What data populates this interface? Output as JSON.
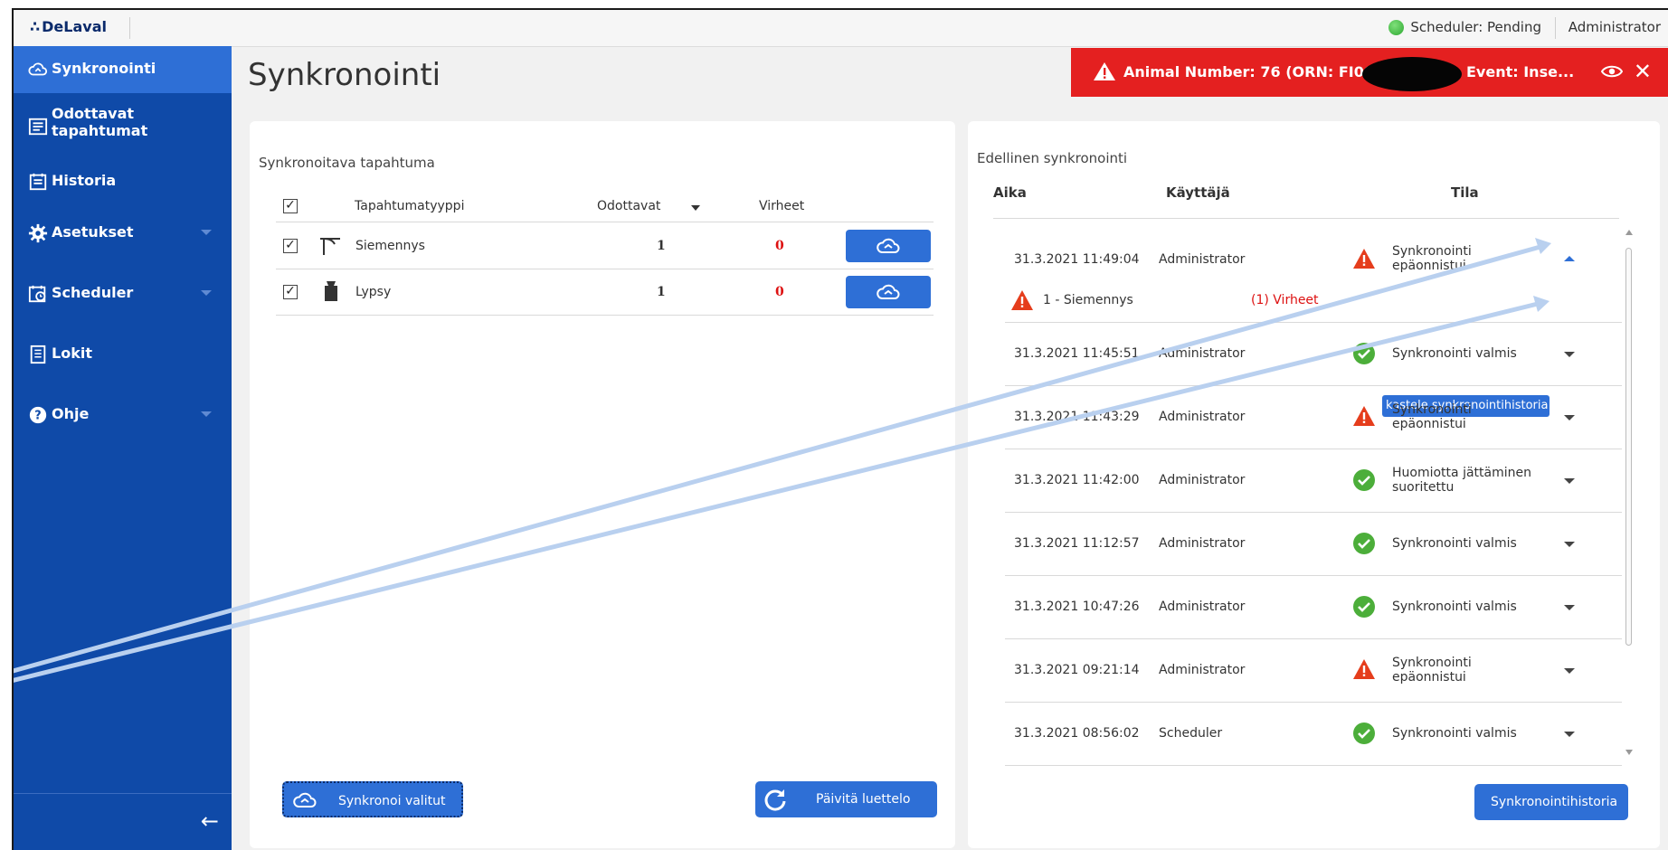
{
  "topbar": {
    "logo": "DeLaval",
    "scheduler_status": "Scheduler: Pending",
    "user": "Administrator"
  },
  "sidebar": {
    "items": [
      {
        "label": "Synkronointi",
        "icon": "cloud-sync-icon",
        "active": true
      },
      {
        "label": "Odottavat tapahtumat",
        "icon": "pending-list-icon"
      },
      {
        "label": "Historia",
        "icon": "history-icon"
      },
      {
        "label": "Asetukset",
        "icon": "gear-icon",
        "has_submenu": true
      },
      {
        "label": "Scheduler",
        "icon": "calendar-clock-icon",
        "has_submenu": true
      },
      {
        "label": "Lokit",
        "icon": "log-icon"
      },
      {
        "label": "Ohje",
        "icon": "help-icon",
        "has_submenu": true
      }
    ],
    "collapse_icon": "arrow-left-icon"
  },
  "page": {
    "title": "Synkronointi"
  },
  "alert": {
    "text_prefix": "Animal Number: 76 (ORN: FI0000",
    "text_suffix": "Event: Inse...",
    "color": "#e42020"
  },
  "left_panel": {
    "title": "Synkronoitava tapahtuma",
    "headers": {
      "type": "Tapahtumatyyppi",
      "pending": "Odottavat",
      "errors": "Virheet"
    },
    "rows": [
      {
        "type": "Siemennys",
        "icon": "insemination-icon",
        "pending": "1",
        "errors": "0"
      },
      {
        "type": "Lypsy",
        "icon": "milking-icon",
        "pending": "1",
        "errors": "0"
      }
    ],
    "sync_selected_label": "Synkronoi valitut",
    "refresh_label": "Päivitä luettelo"
  },
  "right_panel": {
    "title": "Edellinen synkronointi",
    "headers": {
      "time": "Aika",
      "user": "Käyttäjä",
      "status": "Tila"
    },
    "rows": [
      {
        "time": "31.3.2021 11:49:04",
        "user": "Administrator",
        "status": "Synkronointi epäonnistui",
        "ok": false,
        "expanded": true
      },
      {
        "time": "31.3.2021 11:45:51",
        "user": "Administrator",
        "status": "Synkronointi valmis",
        "ok": true
      },
      {
        "time": "31.3.2021 11:43:29",
        "user": "Administrator",
        "status": "Synkronointi epäonnistui",
        "ok": false
      },
      {
        "time": "31.3.2021 11:42:00",
        "user": "Administrator",
        "status": "Huomiotta jättäminen suoritettu",
        "ok": true
      },
      {
        "time": "31.3.2021 11:12:57",
        "user": "Administrator",
        "status": "Synkronointi valmis",
        "ok": true
      },
      {
        "time": "31.3.2021 10:47:26",
        "user": "Administrator",
        "status": "Synkronointi valmis",
        "ok": true
      },
      {
        "time": "31.3.2021 09:21:14",
        "user": "Administrator",
        "status": "Synkronointi epäonnistui",
        "ok": false
      },
      {
        "time": "31.3.2021 08:56:02",
        "user": "Scheduler",
        "status": "Synkronointi valmis",
        "ok": true
      }
    ],
    "detail": {
      "label": "1 - Siemennys",
      "errors": "(1) Virheet",
      "link": "kastele synkronointihistoria"
    },
    "history_button": "Synkronointihistoria"
  },
  "colors": {
    "sidebar": "#0f4aa8",
    "active": "#2e6fd6",
    "ok": "#4cae3a",
    "error": "#e53d1c"
  }
}
